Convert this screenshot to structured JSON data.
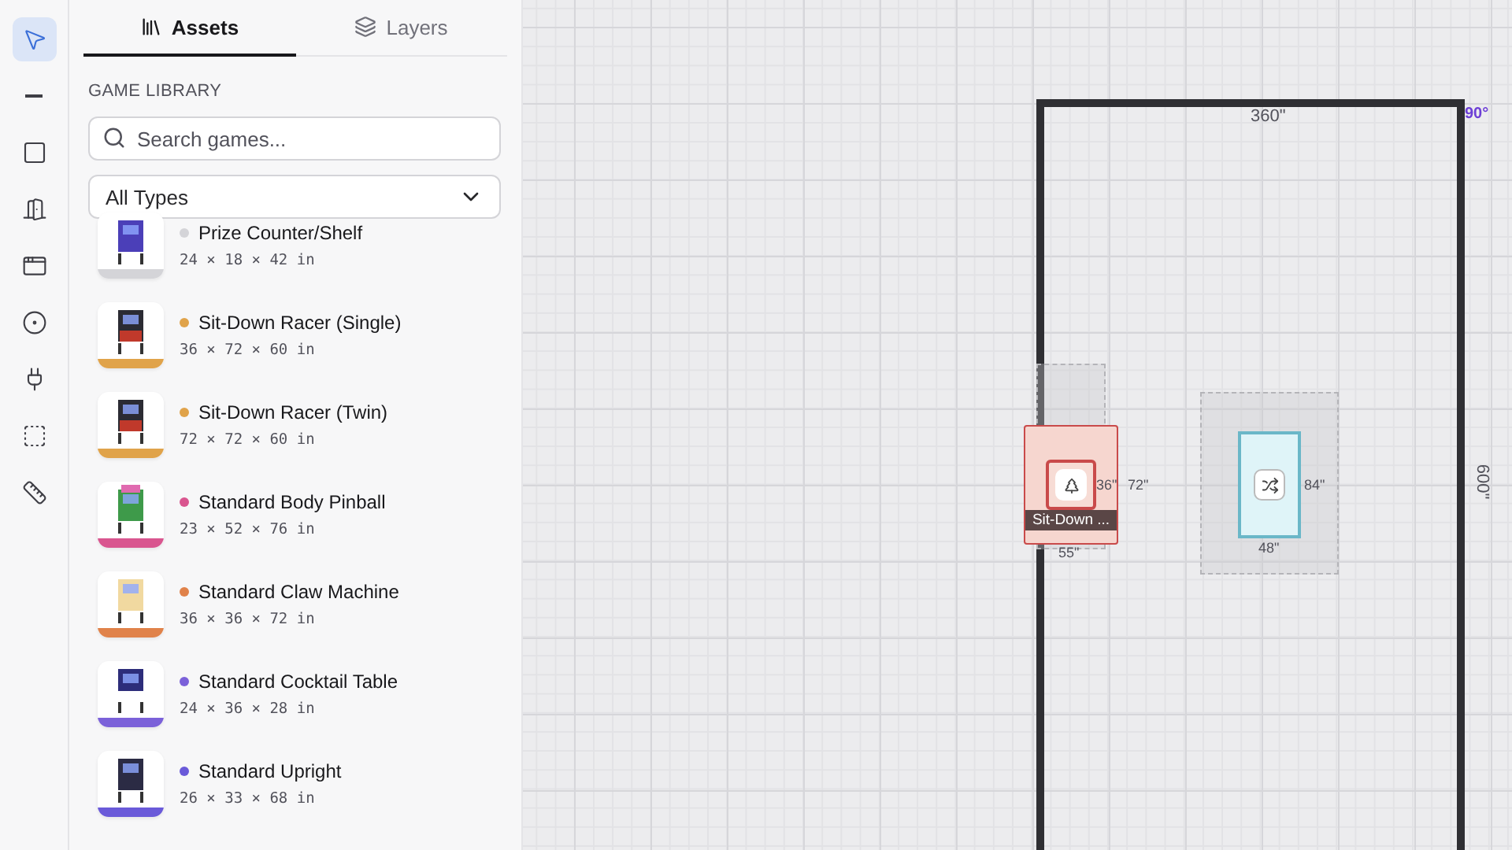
{
  "tools": [
    {
      "kind": "select",
      "selected": true
    },
    {
      "kind": "line",
      "selected": false
    },
    {
      "kind": "rect",
      "selected": false
    },
    {
      "kind": "door",
      "selected": false
    },
    {
      "kind": "window",
      "selected": false
    },
    {
      "kind": "target",
      "selected": false
    },
    {
      "kind": "plug",
      "selected": false
    },
    {
      "kind": "marquee",
      "selected": false
    },
    {
      "kind": "ruler",
      "selected": false
    }
  ],
  "tabs": [
    {
      "label": "Assets",
      "kind": "library",
      "selected": true
    },
    {
      "label": "Layers",
      "kind": "layers",
      "selected": false
    }
  ],
  "section_title": "GAME LIBRARY",
  "search": {
    "placeholder": "Search games..."
  },
  "type_filter": {
    "value": "All Types"
  },
  "games": [
    {
      "name": "Prize Counter/Shelf",
      "dims": "24 × 18 × 42 in",
      "color": "#d4d4d8",
      "kind": "counter"
    },
    {
      "name": "Sit-Down Racer (Single)",
      "dims": "36 × 72 × 60 in",
      "color": "#e0a34a",
      "kind": "racer"
    },
    {
      "name": "Sit-Down Racer (Twin)",
      "dims": "72 × 72 × 60 in",
      "color": "#e0a34a",
      "kind": "racer"
    },
    {
      "name": "Standard Body Pinball",
      "dims": "23 × 52 × 76 in",
      "color": "#d9558f",
      "kind": "pinball"
    },
    {
      "name": "Standard Claw Machine",
      "dims": "36 × 36 × 72 in",
      "color": "#e0824a",
      "kind": "claw"
    },
    {
      "name": "Standard Cocktail Table",
      "dims": "24 × 36 × 28 in",
      "color": "#7b61d9",
      "kind": "cocktail"
    },
    {
      "name": "Standard Upright",
      "dims": "26 × 33 × 68 in",
      "color": "#6a5ad9",
      "kind": "upright"
    }
  ],
  "canvas": {
    "room": {
      "top_label": "360\"",
      "side_label": "600\"",
      "corner_label": "90°"
    },
    "objects": [
      {
        "kind": "game",
        "label": "Sit-Down ...",
        "width_label": "36\"",
        "depth_label": "72\"",
        "bottom_label": "55\""
      },
      {
        "kind": "zone",
        "width_label": "48\"",
        "depth_label": "84\""
      }
    ]
  }
}
